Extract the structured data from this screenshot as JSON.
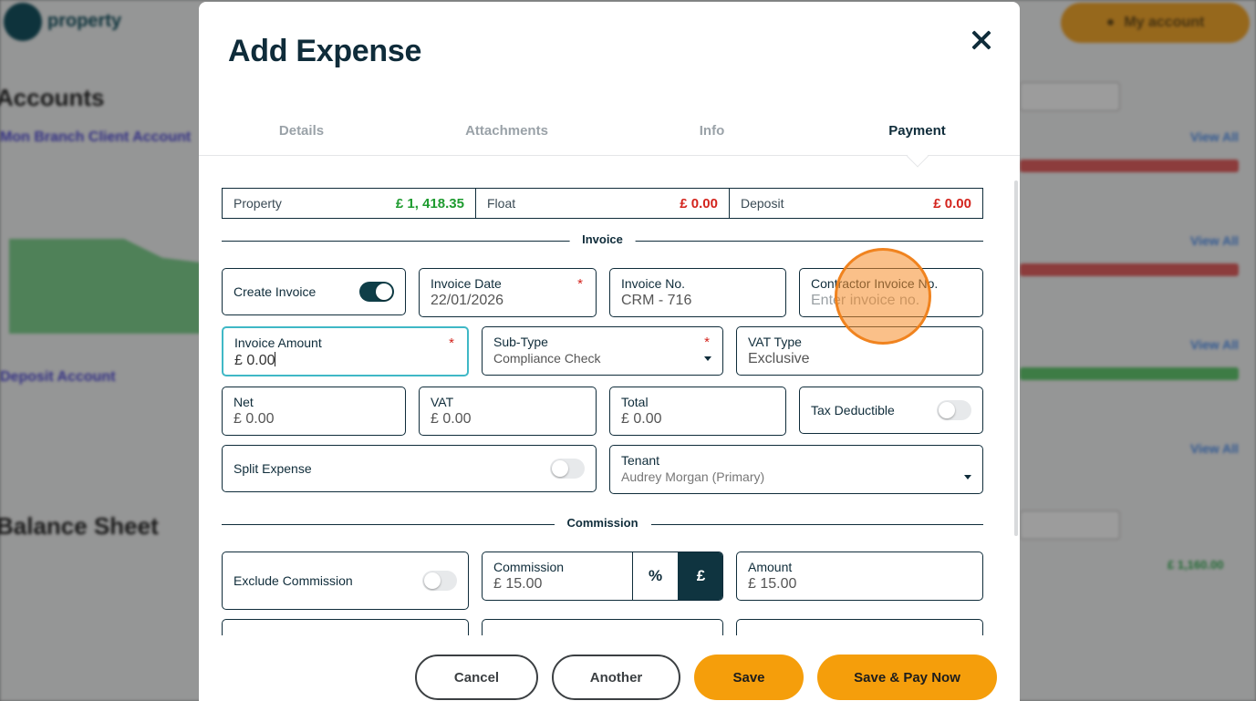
{
  "modal": {
    "title": "Add Expense",
    "close_label": "×"
  },
  "tabs": [
    {
      "label": "Details",
      "active": false
    },
    {
      "label": "Attachments",
      "active": false
    },
    {
      "label": "Info",
      "active": false
    },
    {
      "label": "Payment",
      "active": true
    }
  ],
  "balances": {
    "property": {
      "label": "Property",
      "amount": "£ 1, 418.35"
    },
    "float": {
      "label": "Float",
      "amount": "£ 0.00"
    },
    "deposit": {
      "label": "Deposit",
      "amount": "£ 0.00"
    }
  },
  "invoice_section": {
    "label": "Invoice",
    "create_invoice": {
      "label": "Create Invoice",
      "on": true
    },
    "invoice_date": {
      "label": "Invoice Date",
      "value": "22/01/2026",
      "required": "*"
    },
    "invoice_no": {
      "label": "Invoice No.",
      "value": "CRM - 716"
    },
    "contractor_invoice_no": {
      "label": "Contractor Invoice No.",
      "placeholder": "Enter invoice no."
    },
    "invoice_amount": {
      "label": "Invoice Amount",
      "value": "£ 0.00",
      "required": "*"
    },
    "sub_type": {
      "label": "Sub-Type",
      "value": "Compliance Check",
      "required": "*"
    },
    "vat_type": {
      "label": "VAT Type",
      "value": "Exclusive"
    },
    "net": {
      "label": "Net",
      "value": "£ 0.00"
    },
    "vat": {
      "label": "VAT",
      "value": "£ 0.00"
    },
    "total": {
      "label": "Total",
      "value": "£ 0.00"
    },
    "tax_deductible": {
      "label": "Tax Deductible",
      "on": false
    },
    "split_expense": {
      "label": "Split Expense",
      "on": false
    },
    "tenant": {
      "label": "Tenant",
      "value": "Audrey Morgan (Primary)"
    }
  },
  "commission_section": {
    "label": "Commission",
    "exclude_commission": {
      "label": "Exclude Commission",
      "on": false
    },
    "commission": {
      "label": "Commission",
      "value": "£ 15.00",
      "percent_label": "%",
      "pound_label": "£",
      "selected_unit": "£"
    },
    "amount": {
      "label": "Amount",
      "value": "£ 15.00"
    }
  },
  "footer": {
    "cancel": "Cancel",
    "another": "Another",
    "save": "Save",
    "save_pay": "Save & Pay Now"
  },
  "background": {
    "logo_text": "property",
    "account_button": "My account",
    "accounts_title": "Accounts",
    "client_account_link": "Mon Branch Client Account",
    "deposit_account_link": "Deposit Account",
    "balance_sheet_title": "Balance Sheet",
    "view_all": "View All",
    "balance_total": "£ 1,160.00"
  },
  "colors": {
    "primary_dark": "#0f2c3a",
    "accent_orange": "#f59e0b",
    "positive_green": "#1e9b2f",
    "negative_red": "#d3231c",
    "focus_teal": "#3fb8c6"
  }
}
